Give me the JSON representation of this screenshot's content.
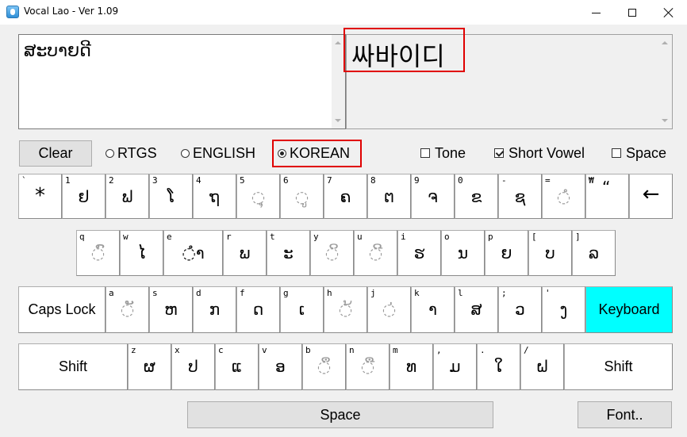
{
  "window": {
    "title": "Vocal Lao - Ver 1.09"
  },
  "input_text": "ສະບາຍດີ",
  "output_text": "싸바이디",
  "controls": {
    "clear_label": "Clear",
    "modes": [
      {
        "label": "RTGS",
        "selected": false
      },
      {
        "label": "ENGLISH",
        "selected": false
      },
      {
        "label": "KOREAN",
        "selected": true
      }
    ],
    "options": [
      {
        "label": "Tone",
        "checked": false
      },
      {
        "label": "Short Vowel",
        "checked": true
      },
      {
        "label": "Space",
        "checked": false
      }
    ]
  },
  "keyboard": {
    "row1": [
      {
        "sub": "`",
        "main": "*"
      },
      {
        "sub": "1",
        "main": "ຢ"
      },
      {
        "sub": "2",
        "main": "ຟ"
      },
      {
        "sub": "3",
        "main": "ໂ"
      },
      {
        "sub": "4",
        "main": "ຖ"
      },
      {
        "sub": "5",
        "main": "◌ຸ"
      },
      {
        "sub": "6",
        "main": "◌ູ"
      },
      {
        "sub": "7",
        "main": "ຄ"
      },
      {
        "sub": "8",
        "main": "ຕ"
      },
      {
        "sub": "9",
        "main": "ຈ"
      },
      {
        "sub": "0",
        "main": "ຂ"
      },
      {
        "sub": "-",
        "main": "ຊ"
      },
      {
        "sub": "=",
        "main": "◌ໍ"
      },
      {
        "sub": "₩",
        "main": "“"
      },
      {
        "sub": "",
        "main": "←"
      }
    ],
    "row2": [
      {
        "sub": "q",
        "main": "◌ົ"
      },
      {
        "sub": "w",
        "main": "ໄ"
      },
      {
        "sub": "e",
        "main": "◌ຳ"
      },
      {
        "sub": "r",
        "main": "ພ"
      },
      {
        "sub": "t",
        "main": "ະ"
      },
      {
        "sub": "y",
        "main": "◌ິ"
      },
      {
        "sub": "u",
        "main": "◌ີ"
      },
      {
        "sub": "i",
        "main": "ຮ"
      },
      {
        "sub": "o",
        "main": "ນ"
      },
      {
        "sub": "p",
        "main": "ຍ"
      },
      {
        "sub": "[",
        "main": "ບ"
      },
      {
        "sub": "]",
        "main": "ລ"
      }
    ],
    "caps_label": "Caps Lock",
    "row3": [
      {
        "sub": "a",
        "main": "◌ັ"
      },
      {
        "sub": "s",
        "main": "ຫ"
      },
      {
        "sub": "d",
        "main": "ກ"
      },
      {
        "sub": "f",
        "main": "ດ"
      },
      {
        "sub": "g",
        "main": "ເ"
      },
      {
        "sub": "h",
        "main": "◌້"
      },
      {
        "sub": "j",
        "main": "◌່"
      },
      {
        "sub": "k",
        "main": "າ"
      },
      {
        "sub": "l",
        "main": "ສ"
      },
      {
        "sub": ";",
        "main": "ວ"
      },
      {
        "sub": "'",
        "main": "ງ"
      }
    ],
    "keyboard_label": "Keyboard",
    "shift_label": "Shift",
    "row4": [
      {
        "sub": "z",
        "main": "ຜ"
      },
      {
        "sub": "x",
        "main": "ປ"
      },
      {
        "sub": "c",
        "main": "ແ"
      },
      {
        "sub": "v",
        "main": "ອ"
      },
      {
        "sub": "b",
        "main": "◌ຶ"
      },
      {
        "sub": "n",
        "main": "◌ື"
      },
      {
        "sub": "m",
        "main": "ທ"
      },
      {
        "sub": ",",
        "main": "ມ"
      },
      {
        "sub": ".",
        "main": "ໃ"
      },
      {
        "sub": "/",
        "main": "ຝ"
      }
    ],
    "space_label": "Space",
    "font_label": "Font.."
  },
  "colors": {
    "highlight_key": "#00ffff",
    "annotation_box": "#e00000"
  }
}
